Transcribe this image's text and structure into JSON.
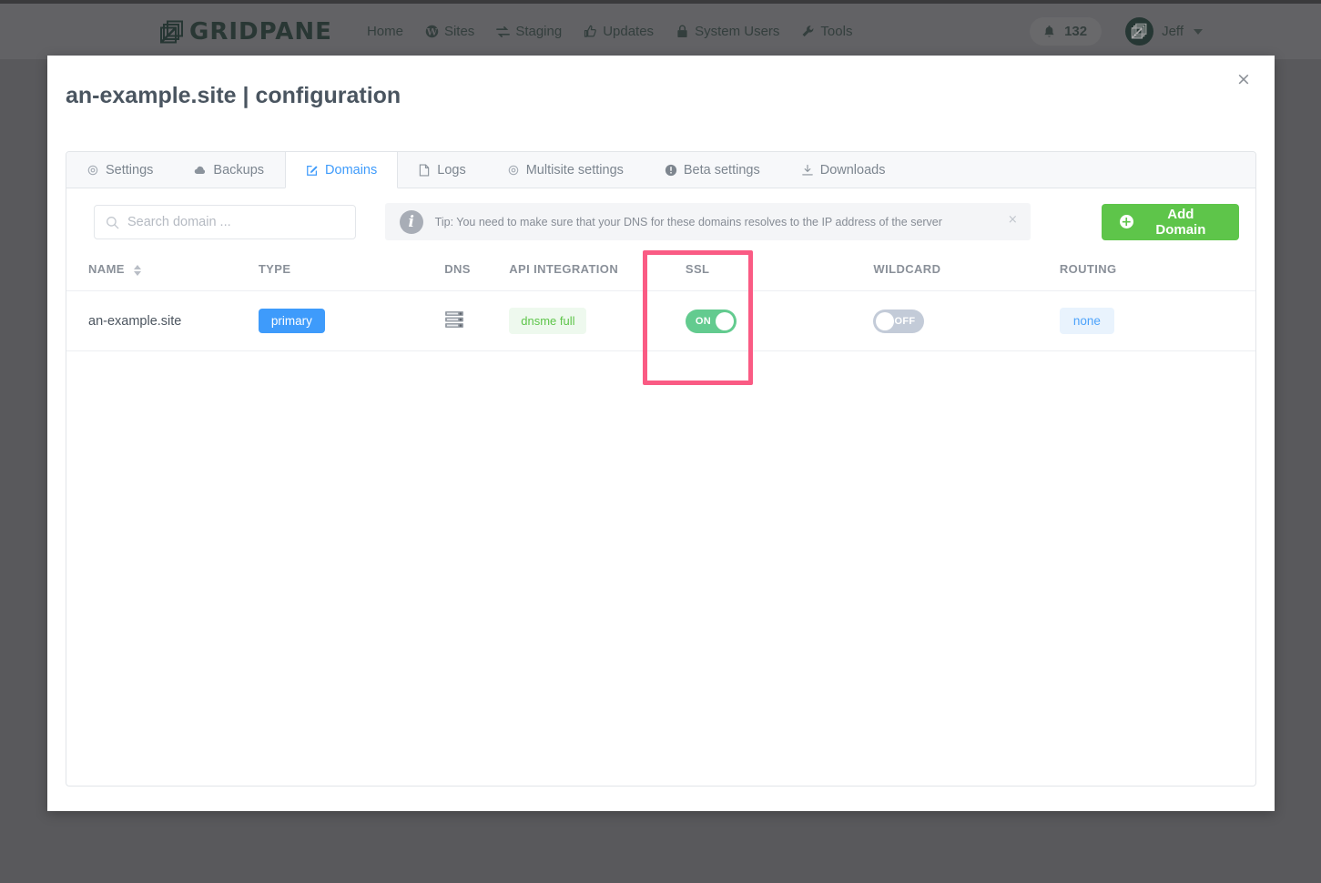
{
  "navbar": {
    "brand": "GRIDPANE",
    "brand_logo_icon": "gridpane-logo-icon",
    "links": [
      {
        "label": "Home",
        "icon": ""
      },
      {
        "label": "Sites",
        "icon": "wordpress-icon"
      },
      {
        "label": "Staging",
        "icon": "sync-icon"
      },
      {
        "label": "Updates",
        "icon": "thumbs-up-icon"
      },
      {
        "label": "System Users",
        "icon": "lock-icon"
      },
      {
        "label": "Tools",
        "icon": "wrench-icon"
      }
    ],
    "notifications": {
      "icon": "bell-icon",
      "count": "132"
    },
    "user": {
      "name": "Jeff",
      "avatar_icon": "user-avatar-icon",
      "caret_icon": "chevron-down-icon"
    }
  },
  "modal": {
    "title": "an-example.site | configuration",
    "close_icon": "close-icon",
    "close_label": "×"
  },
  "tabs": [
    {
      "label": "Settings",
      "icon": "gear-icon",
      "active": false
    },
    {
      "label": "Backups",
      "icon": "cloud-icon",
      "active": false
    },
    {
      "label": "Domains",
      "icon": "edit-square-icon",
      "active": true
    },
    {
      "label": "Logs",
      "icon": "document-icon",
      "active": false
    },
    {
      "label": "Multisite settings",
      "icon": "gear-icon",
      "active": false
    },
    {
      "label": "Beta settings",
      "icon": "exclamation-circle-icon",
      "active": false
    },
    {
      "label": "Downloads",
      "icon": "download-icon",
      "active": false
    }
  ],
  "toolbar": {
    "search": {
      "placeholder": "Search domain ...",
      "value": "",
      "icon": "search-icon"
    },
    "tip": {
      "icon": "info-icon",
      "text": "Tip: You need to make sure that your DNS for these domains resolves to the IP address of the server",
      "close_label": "×"
    },
    "add_button": {
      "label": "Add Domain",
      "icon": "plus-circle-icon"
    }
  },
  "table": {
    "columns": [
      {
        "key": "name",
        "label": "NAME",
        "sortable": true,
        "sort_icon": "sort-arrows-icon"
      },
      {
        "key": "type",
        "label": "TYPE",
        "sortable": false
      },
      {
        "key": "dns",
        "label": "DNS",
        "sortable": false
      },
      {
        "key": "api",
        "label": "API INTEGRATION",
        "sortable": false
      },
      {
        "key": "ssl",
        "label": "SSL",
        "sortable": false
      },
      {
        "key": "wildcard",
        "label": "WILDCARD",
        "sortable": false
      },
      {
        "key": "routing",
        "label": "ROUTING",
        "sortable": false
      }
    ],
    "rows": [
      {
        "name": "an-example.site",
        "type": "primary",
        "dns_icon": "server-stack-icon",
        "api": "dnsme full",
        "ssl": {
          "state": "on",
          "label": "ON"
        },
        "wildcard": {
          "state": "off",
          "label": "OFF"
        },
        "routing": "none"
      }
    ]
  },
  "annotation": {
    "target": "ssl-column-highlight",
    "color": "#fa5b84"
  },
  "colors": {
    "accent_blue": "#3e9bfb",
    "green": "#5ec54a",
    "toggle_on": "#63cb8f",
    "toggle_off": "#c3cbd8",
    "highlight_pink": "#fa5b84",
    "overlay": "#727275"
  }
}
